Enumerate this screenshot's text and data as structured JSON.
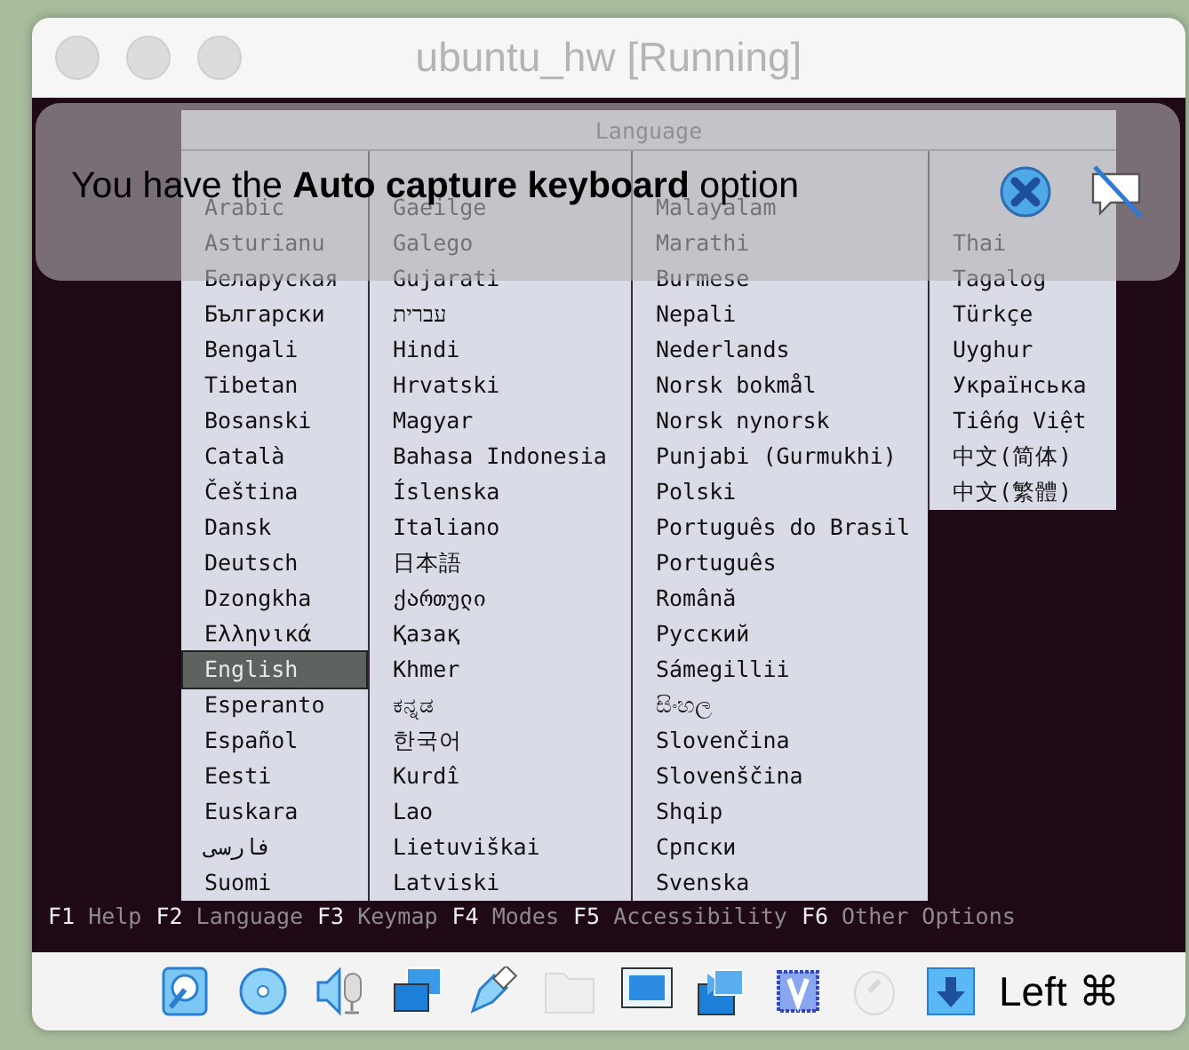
{
  "window": {
    "title": "ubuntu_hw [Running]"
  },
  "language_menu": {
    "title": "Language",
    "columns": [
      {
        "items": [
          {
            "covered": true,
            "selected": false
          },
          {
            "label": "Arabic",
            "selected": false
          },
          {
            "label": "Asturianu",
            "selected": false
          },
          {
            "label": "Беларуская",
            "selected": false
          },
          {
            "label": "Български",
            "selected": false
          },
          {
            "label": "Bengali",
            "selected": false
          },
          {
            "label": "Tibetan",
            "selected": false
          },
          {
            "label": "Bosanski",
            "selected": false
          },
          {
            "label": "Català",
            "selected": false
          },
          {
            "label": "Čeština",
            "selected": false
          },
          {
            "label": "Dansk",
            "selected": false
          },
          {
            "label": "Deutsch",
            "selected": false
          },
          {
            "label": "Dzongkha",
            "selected": false
          },
          {
            "label": "Ελληνικά",
            "selected": false
          },
          {
            "label": "English",
            "selected": true
          },
          {
            "label": "Esperanto",
            "selected": false
          },
          {
            "label": "Español",
            "selected": false
          },
          {
            "label": "Eesti",
            "selected": false
          },
          {
            "label": "Euskara",
            "selected": false
          },
          {
            "label": "فارسی",
            "selected": false
          },
          {
            "label": "Suomi",
            "selected": false
          }
        ]
      },
      {
        "items": [
          {
            "covered": true,
            "selected": false
          },
          {
            "label": "Gaeilge",
            "selected": false
          },
          {
            "label": "Galego",
            "selected": false
          },
          {
            "label": "Gujarati",
            "selected": false
          },
          {
            "label": "עברית",
            "selected": false
          },
          {
            "label": "Hindi",
            "selected": false
          },
          {
            "label": "Hrvatski",
            "selected": false
          },
          {
            "label": "Magyar",
            "selected": false
          },
          {
            "label": "Bahasa Indonesia",
            "selected": false
          },
          {
            "label": "Íslenska",
            "selected": false
          },
          {
            "label": "Italiano",
            "selected": false
          },
          {
            "label": "日本語",
            "selected": false
          },
          {
            "label": "ქართული",
            "selected": false
          },
          {
            "label": "Қазақ",
            "selected": false
          },
          {
            "label": "Khmer",
            "selected": false
          },
          {
            "label": "ಕನ್ನಡ",
            "selected": false
          },
          {
            "label": "한국어",
            "selected": false
          },
          {
            "label": "Kurdî",
            "selected": false
          },
          {
            "label": "Lao",
            "selected": false
          },
          {
            "label": "Lietuviškai",
            "selected": false
          },
          {
            "label": "Latviski",
            "selected": false
          }
        ]
      },
      {
        "items": [
          {
            "covered": true,
            "selected": false
          },
          {
            "label": "Malayalam",
            "selected": false
          },
          {
            "label": "Marathi",
            "selected": false
          },
          {
            "label": "Burmese",
            "selected": false
          },
          {
            "label": "Nepali",
            "selected": false
          },
          {
            "label": "Nederlands",
            "selected": false
          },
          {
            "label": "Norsk bokmål",
            "selected": false
          },
          {
            "label": "Norsk nynorsk",
            "selected": false
          },
          {
            "label": "Punjabi (Gurmukhi)",
            "selected": false
          },
          {
            "label": "Polski",
            "selected": false
          },
          {
            "label": "Português do Brasil",
            "selected": false
          },
          {
            "label": "Português",
            "selected": false
          },
          {
            "label": "Română",
            "selected": false
          },
          {
            "label": "Русский",
            "selected": false
          },
          {
            "label": "Sámegillii",
            "selected": false
          },
          {
            "label": "සිංහල",
            "selected": false
          },
          {
            "label": "Slovenčina",
            "selected": false
          },
          {
            "label": "Slovenščina",
            "selected": false
          },
          {
            "label": "Shqip",
            "selected": false
          },
          {
            "label": "Српски",
            "selected": false
          },
          {
            "label": "Svenska",
            "selected": false
          }
        ]
      },
      {
        "items": [
          {
            "covered": true,
            "selected": false
          },
          {
            "covered": true,
            "selected": false
          },
          {
            "label": "Thai",
            "selected": false
          },
          {
            "label": "Tagalog",
            "selected": false
          },
          {
            "label": "Türkçe",
            "selected": false
          },
          {
            "label": "Uyghur",
            "selected": false
          },
          {
            "label": "Українська",
            "selected": false
          },
          {
            "label": "Tiếng Việt",
            "selected": false
          },
          {
            "label": "中文(简体)",
            "selected": false
          },
          {
            "label": "中文(繁體)",
            "selected": false
          }
        ]
      }
    ]
  },
  "function_keys": [
    {
      "key": "F1",
      "label": "Help"
    },
    {
      "key": "F2",
      "label": "Language"
    },
    {
      "key": "F3",
      "label": "Keymap"
    },
    {
      "key": "F4",
      "label": "Modes"
    },
    {
      "key": "F5",
      "label": "Accessibility"
    },
    {
      "key": "F6",
      "label": "Other Options"
    }
  ],
  "notification": {
    "message": "You have the **Auto capture keyboard** option"
  },
  "status_bar": {
    "icons": [
      {
        "kind": "disk",
        "disabled": false
      },
      {
        "kind": "disc",
        "disabled": false
      },
      {
        "kind": "audio",
        "disabled": false
      },
      {
        "kind": "network",
        "disabled": false
      },
      {
        "kind": "usb",
        "disabled": false
      },
      {
        "kind": "folder",
        "disabled": true
      },
      {
        "kind": "display",
        "disabled": false
      },
      {
        "kind": "capture",
        "disabled": false
      },
      {
        "kind": "cpu",
        "disabled": false
      },
      {
        "kind": "mouse",
        "disabled": true
      },
      {
        "kind": "keyboard",
        "disabled": false
      }
    ],
    "host_key": "Left ⌘"
  }
}
